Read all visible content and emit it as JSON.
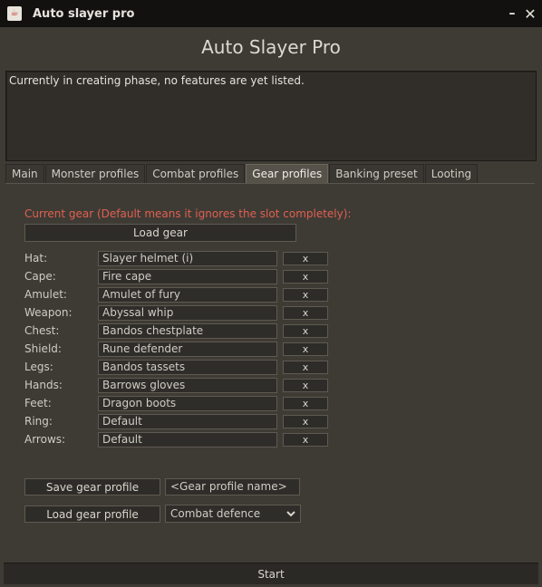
{
  "window": {
    "title": "Auto slayer pro",
    "min_symbol": "–",
    "close_symbol": "✕"
  },
  "header": {
    "title": "Auto Slayer Pro"
  },
  "info": {
    "text": "Currently in creating phase, no features are yet listed."
  },
  "tabs": [
    {
      "label": "Main"
    },
    {
      "label": "Monster profiles"
    },
    {
      "label": "Combat profiles"
    },
    {
      "label": "Gear profiles"
    },
    {
      "label": "Banking preset"
    },
    {
      "label": "Looting"
    }
  ],
  "gear": {
    "current_label": "Current gear (Default means it ignores the slot completely):",
    "load_button": "Load gear",
    "clear_symbol": "x",
    "slots": [
      {
        "label": "Hat:",
        "value": "Slayer helmet (i)"
      },
      {
        "label": "Cape:",
        "value": "Fire cape"
      },
      {
        "label": "Amulet:",
        "value": "Amulet of fury"
      },
      {
        "label": "Weapon:",
        "value": "Abyssal whip"
      },
      {
        "label": "Chest:",
        "value": "Bandos chestplate"
      },
      {
        "label": "Shield:",
        "value": "Rune defender"
      },
      {
        "label": "Legs:",
        "value": "Bandos tassets"
      },
      {
        "label": "Hands:",
        "value": "Barrows gloves"
      },
      {
        "label": "Feet:",
        "value": "Dragon boots"
      },
      {
        "label": "Ring:",
        "value": "Default"
      },
      {
        "label": "Arrows:",
        "value": "Default"
      }
    ]
  },
  "profile": {
    "save_button": "Save gear profile",
    "name_value": "<Gear profile name>",
    "load_button": "Load gear profile",
    "selected": "Combat defence"
  },
  "footer": {
    "start_label": "Start"
  },
  "colors": {
    "accent_red": "#e06050",
    "active_tab": "#56524a"
  }
}
